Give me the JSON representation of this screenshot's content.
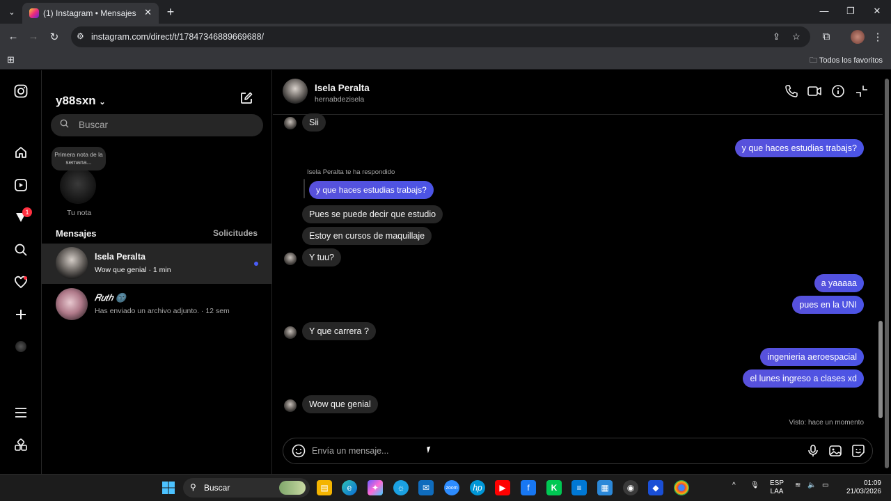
{
  "browser": {
    "tab_title": "(1) Instagram • Mensajes",
    "tab_close": "✕",
    "new_tab": "+",
    "url": "instagram.com/direct/t/17847346889669688/",
    "bookmarks_folder": "Todos los favoritos"
  },
  "sidebar": {
    "username": "y88sxn",
    "search_placeholder": "Buscar",
    "note_text": "Primera nota de la semana...",
    "note_label": "Tu nota",
    "section_title": "Mensajes",
    "requests": "Solicitudes",
    "conversations": [
      {
        "name": "Isela Peralta",
        "preview": "Wow que genial · 1 min",
        "unread": true
      },
      {
        "name": "𝑅𝑢𝑡ℎ 🌚",
        "preview": "Has enviado un archivo adjunto. · 12 sem",
        "unread": false
      }
    ],
    "notification_count": "1"
  },
  "chat": {
    "name": "Isela Peralta",
    "handle": "hernabdezisela",
    "reply_label": "Isela Peralta te ha respondido",
    "messages": {
      "m1": "Sii",
      "m2": "y que haces estudias trabajs?",
      "m3": "y que haces estudias trabajs?",
      "m4": "Pues se puede decir que estudio",
      "m5": "Estoy en cursos de maquillaje",
      "m6": "Y tuu?",
      "m7": "a yaaaaa",
      "m8": "pues en la UNI",
      "m9": "Y que carrera ?",
      "m10": "ingenieria aeroespacial",
      "m11": "el lunes ingreso a clases xd",
      "m12": "Wow que genial"
    },
    "seen": "Visto: hace un momento",
    "composer_placeholder": "Envía un mensaje..."
  },
  "taskbar": {
    "search_label": "Buscar",
    "lang_top": "ESP",
    "lang_bottom": "LAA",
    "time": "01:09",
    "date": "21/03/2026"
  },
  "colors": {
    "outgoing_bubble": "#4b54e6",
    "incoming_bubble": "#262626",
    "unread_dot": "#4a5df9",
    "badge": "#ff3040"
  }
}
